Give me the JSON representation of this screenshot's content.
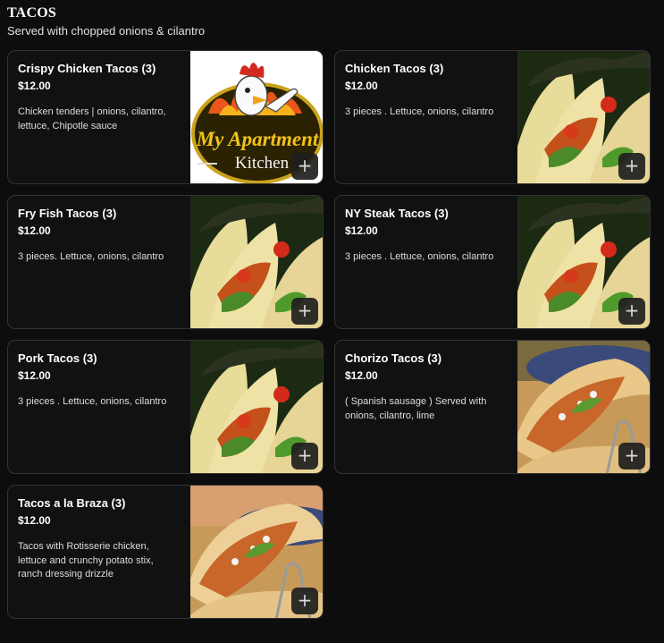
{
  "section": {
    "title": "TACOS",
    "subtitle": "Served with chopped onions & cilantro"
  },
  "items": [
    {
      "name": "Crispy Chicken Tacos (3)",
      "price": "$12.00",
      "description": "Chicken tenders | onions, cilantro, lettuce, Chipotle sauce",
      "image": "logo",
      "logo_text": [
        "My Apartment",
        "Kitchen"
      ]
    },
    {
      "name": "Chicken Tacos (3)",
      "price": "$12.00",
      "description": "3 pieces . Lettuce, onions, cilantro",
      "image": "taco-photo"
    },
    {
      "name": "Fry Fish Tacos (3)",
      "price": "$12.00",
      "description": "3 pieces. Lettuce, onions, cilantro",
      "image": "taco-photo"
    },
    {
      "name": "NY Steak Tacos (3)",
      "price": "$12.00",
      "description": "3 pieces . Lettuce, onions, cilantro",
      "image": "taco-photo"
    },
    {
      "name": "Pork Tacos (3)",
      "price": "$12.00",
      "description": "3 pieces . Lettuce, onions, cilantro",
      "image": "taco-photo"
    },
    {
      "name": "Chorizo Tacos (3)",
      "price": "$12.00",
      "description": "( Spanish sausage ) Served with onions, cilantro, lime",
      "image": "taco-holder-photo"
    },
    {
      "name": "Tacos a la Braza (3)",
      "price": "$12.00",
      "description": "Tacos with Rotisserie chicken, lettuce and crunchy potato stix, ranch dressing drizzle",
      "image": "taco-holder-photo"
    }
  ],
  "add_button": {
    "icon": "plus-icon",
    "glyph": "+"
  },
  "colors": {
    "background": "#0d0d0d",
    "card": "#111111",
    "border": "#333333"
  }
}
